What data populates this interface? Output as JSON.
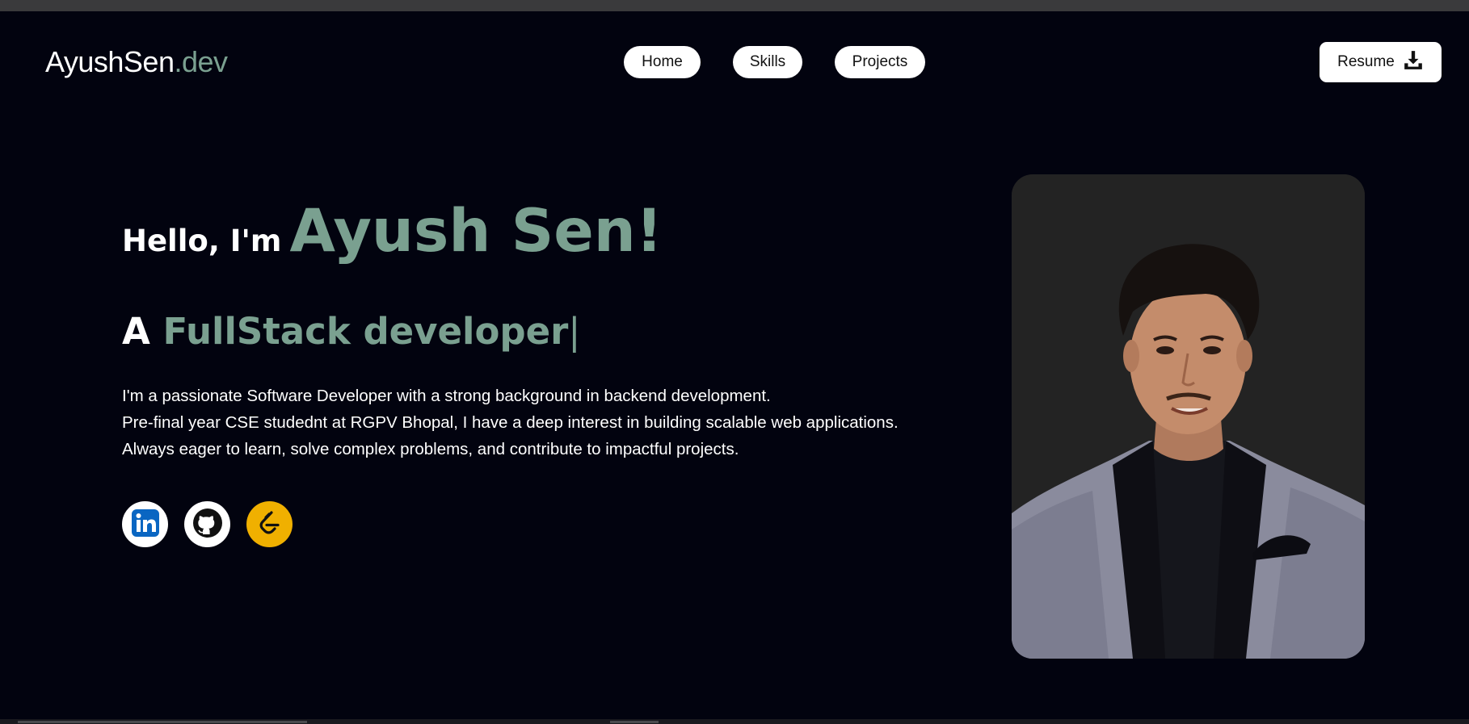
{
  "brand": {
    "name": "AyushSen",
    "suffix": ".dev"
  },
  "nav": {
    "items": [
      {
        "label": "Home"
      },
      {
        "label": "Skills"
      },
      {
        "label": "Projects"
      }
    ],
    "resume_label": "Resume",
    "resume_icon": "download-icon"
  },
  "hero": {
    "greeting": "Hello, I'm",
    "name": "Ayush Sen!",
    "role_prefix": "A",
    "role": "FullStack developer",
    "cursor": "|",
    "bio": [
      "I'm a passionate Software Developer with a strong background in backend development.",
      "Pre-final year CSE studednt at RGPV Bhopal, I have a deep interest in building scalable web applications.",
      "Always eager to learn, solve complex problems, and contribute to impactful projects."
    ]
  },
  "socials": [
    {
      "name": "LinkedIn",
      "icon": "linkedin-icon",
      "color": "#0a66c2",
      "bg": "#ffffff"
    },
    {
      "name": "GitHub",
      "icon": "github-icon",
      "color": "#111111",
      "bg": "#ffffff"
    },
    {
      "name": "LeetCode",
      "icon": "leetcode-icon",
      "color": "#111111",
      "bg": "#f0b000"
    }
  ],
  "colors": {
    "background": "#02030f",
    "accent": "#7aa090",
    "text": "#ffffff",
    "button_bg": "#ffffff"
  }
}
